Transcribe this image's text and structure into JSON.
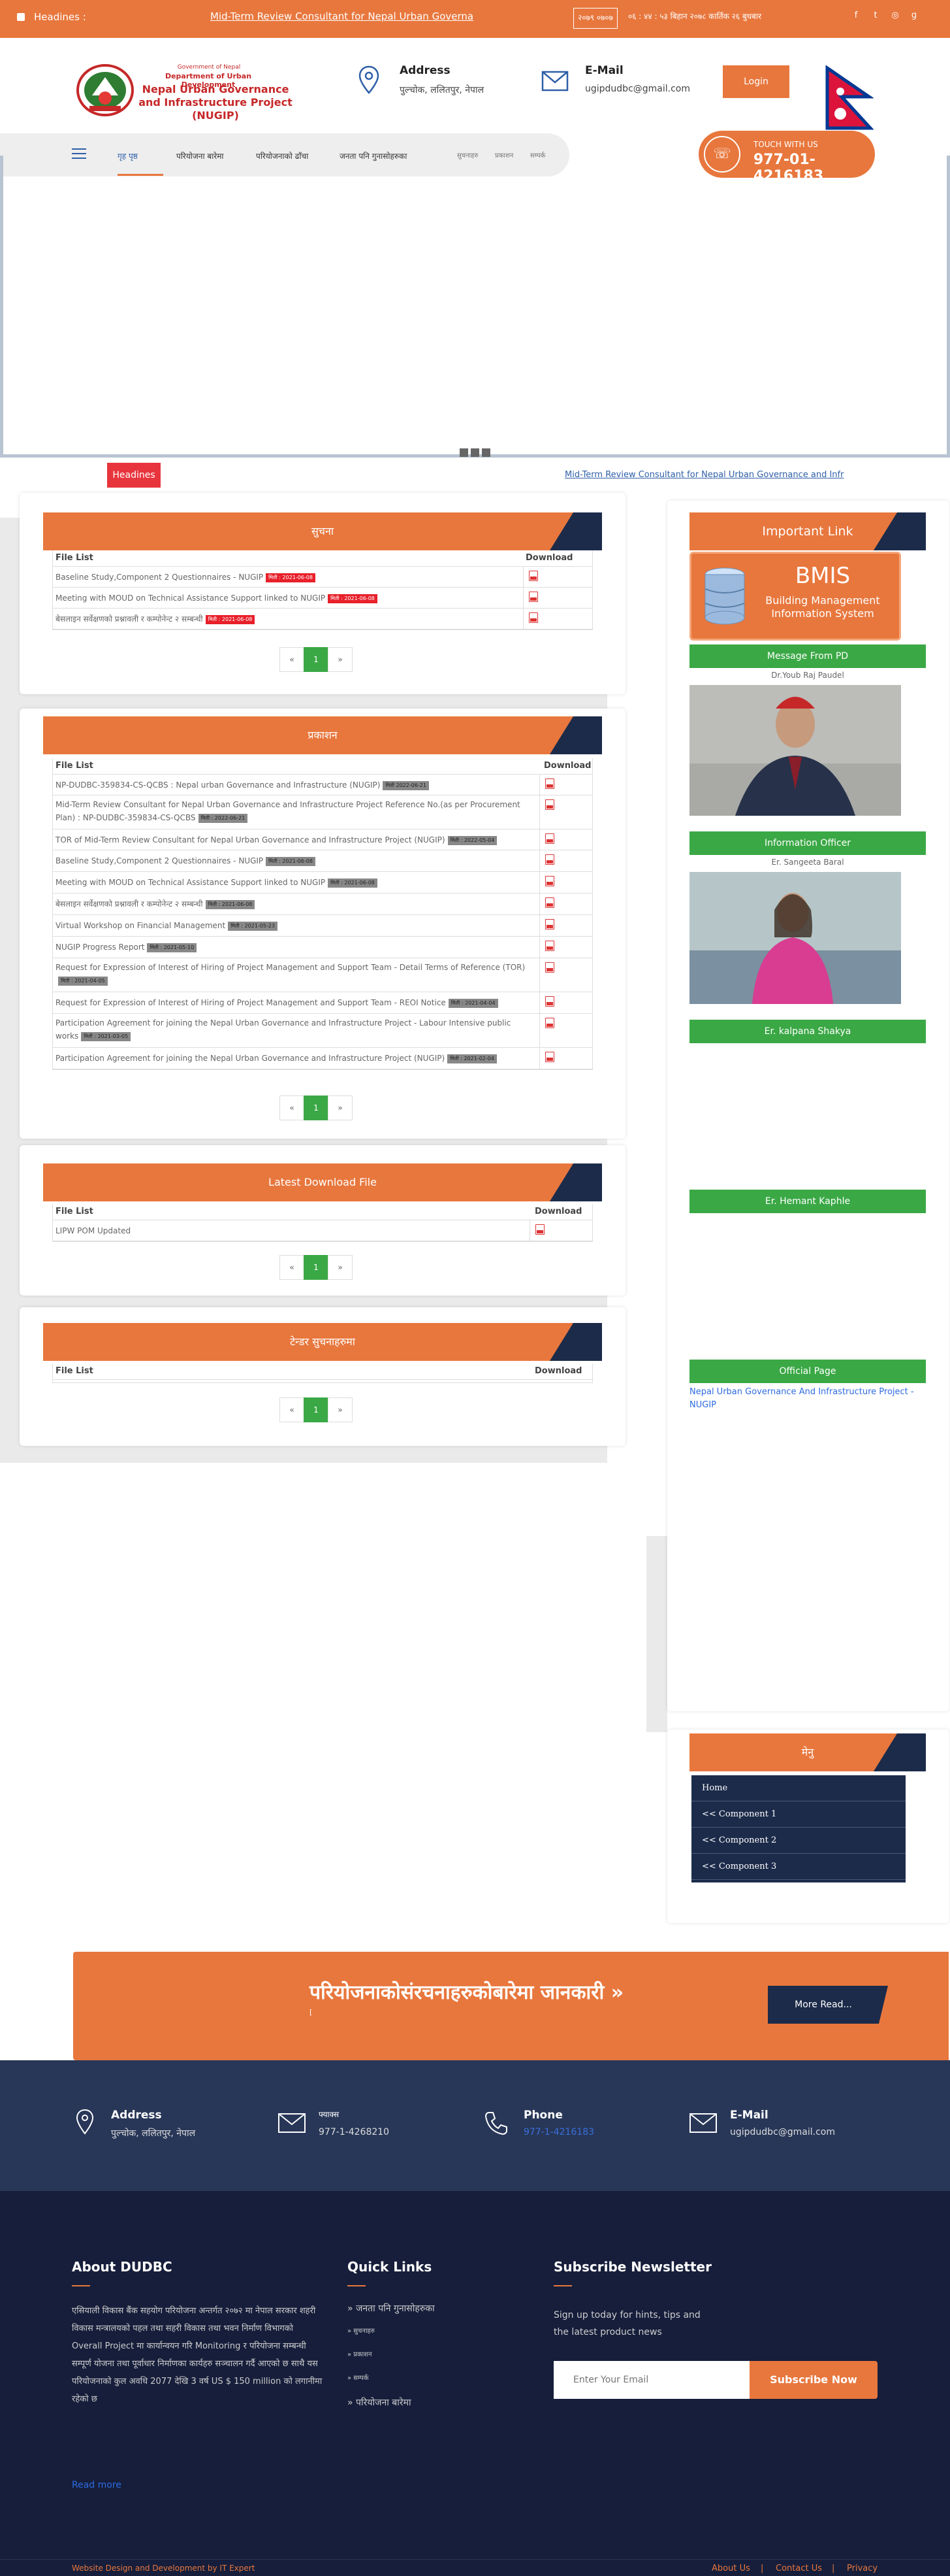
{
  "topbar": {
    "headlines_label": "Headines :",
    "marquee": "Mid-Term Review Consultant for Nepal Urban Governa",
    "datebox": "२०७९ ०७०७",
    "date": "०६ : ४४ : ५३ बिहान २०७८ कार्तिक २६ बुधबार",
    "social": [
      "f",
      "t",
      "◎",
      "g"
    ]
  },
  "header": {
    "gov": "Government of Nepal",
    "dept": "Department of Urban Development",
    "project": "Nepal Urban Governance and Infrastructure Project (NUGIP)",
    "address_title": "Address",
    "address_value": "पुल्चोक, ललितपुर, नेपाल",
    "email_title": "E-Mail",
    "email_value": "ugipdudbc@gmail.com",
    "login": "Login"
  },
  "nav": {
    "items": [
      "गृह पृष्ठ",
      "परियोजना बारेमा",
      "परियोजनाको ढाँचा",
      "जनता पनि गुनासोहरुका",
      "सुचनाहरु",
      "प्रकाशन",
      "सम्पर्क"
    ]
  },
  "touch": {
    "label": "TOUCH WITH US",
    "phone": "977-01-4216183"
  },
  "headline_bar": {
    "tag": "Headines",
    "link": "Mid-Term Review Consultant for Nepal Urban Governance and Infr"
  },
  "panels": [
    {
      "title": "सुचना",
      "col1": "File List",
      "col2": "Download",
      "rows": [
        {
          "text": "Baseline Study,Component 2 Questionnaires - NUGIP",
          "date": "मिती : 2021-06-08"
        },
        {
          "text": "Meeting with MOUD on Technical Assistance Support linked to NUGIP",
          "date": "मिती : 2021-06-08"
        },
        {
          "text": "बेसलाइन सर्वेक्षणको प्रश्नावली र कम्पोनेन्ट २ सम्बन्धी",
          "date": "मिती : 2021-06-08"
        }
      ],
      "page": "1"
    },
    {
      "title": "प्रकाशन",
      "col1": "File List",
      "col2": "Download",
      "rows": [
        {
          "text": "NP-DUDBC-359834-CS-QCBS : Nepal urban Governance and Infrastructure (NUGIP)",
          "date": "मिती 2022-06-21"
        },
        {
          "text": "Mid-Term Review Consultant for Nepal Urban Governance and Infrastructure Project Reference No.(as per Procurement Plan) : NP-DUDBC-359834-CS-QCBS",
          "date": "मिती : 2022-06-21"
        },
        {
          "text": "TOR of Mid-Term Review Consultant for Nepal Urban Governance and Infrastructure Project (NUGIP)",
          "date": "मिती : 2022-05-04"
        },
        {
          "text": "Baseline Study,Component 2 Questionnaires - NUGIP",
          "date": "मिती : 2021-06-08"
        },
        {
          "text": "Meeting with MOUD on Technical Assistance Support linked to NUGIP",
          "date": "मिती : 2021-06-08"
        },
        {
          "text": "बेसलाइन सर्वेक्षणको प्रश्नावली र कम्पोनेन्ट २ सम्बन्धी",
          "date": "मिती : 2021-06-08"
        },
        {
          "text": "Virtual Workshop on Financial Management",
          "date": "मिती : 2021-05-23"
        },
        {
          "text": "NUGIP Progress Report",
          "date": "मिती : 2021-05-10"
        },
        {
          "text": "Request for Expression of Interest of Hiring of Project Management and Support Team - Detail Terms of Reference (TOR)",
          "date": "मिती : 2021-04-05"
        },
        {
          "text": "Request for Expression of Interest of Hiring of Project Management and Support Team - REOI Notice",
          "date": "मिती : 2021-04-04"
        },
        {
          "text": "Participation Agreement for joining the Nepal Urban Governance and Infrastructure Project - Labour Intensive public works",
          "date": "मिती : 2021-03-05"
        },
        {
          "text": "Participation Agreement for joining the Nepal Urban Governance and Infrastructure Project (NUGIP)",
          "date": "मिती : 2021-02-04"
        }
      ],
      "page": "1"
    },
    {
      "title": "Latest Download File",
      "col1": "File List",
      "col2": "Download",
      "rows": [
        {
          "text": "LIPW POM Updated",
          "date": ""
        }
      ],
      "page": "1"
    },
    {
      "title": "टेन्डर सुचनाहरुमा",
      "col1": "File List",
      "col2": "Download",
      "rows": [],
      "page": "1"
    }
  ],
  "right": {
    "title": "Important Link",
    "bmis_title": "BMIS",
    "bmis_sub": "Building Management Information System",
    "message": "Message From PD",
    "pd_name": "Dr.Youb Raj Paudel",
    "info": "Information Officer",
    "info_name": "Er. Sangeeta Baral",
    "kalpana": "Er. kalpana Shakya",
    "hemant": "Er. Hemant Kaphle",
    "official": "Official Page",
    "official_link": "Nepal Urban Governance And Infrastructure Project - NUGIP",
    "menu_title": "मेनु",
    "menu": [
      "Home",
      "<< Component 1",
      "<< Component 2",
      "<< Component 3"
    ]
  },
  "banner": {
    "title": "परियोजनाकोसंरचनाहरुकोबारेमा जानकारी »",
    "sub": "[",
    "btn": "More Read..."
  },
  "contact": {
    "addr_t": "Address",
    "addr_v": "पुल्चोक, ललितपुर, नेपाल",
    "fax_t": "फ्याक्स",
    "fax_v": "977-1-4268210",
    "phone_t": "Phone",
    "phone_v": "977-1-4216183",
    "mail_t": "E-Mail",
    "mail_v": "ugipdudbc@gmail.com"
  },
  "footer": {
    "about_title": "About DUDBC",
    "about_text": "एसियाली विकास बैंक सहयोग परियोजना अन्तर्गत २०७२ मा नेपाल सरकार शहरी विकास मन्त्रालयको पहल तथा सहरी विकास तथा भवन निर्माण विभागको Overall Project मा कार्यान्वयन गरि Monitoring र परियोजना सम्बन्धी सम्पूर्ण योजना तथा पूर्वाधार निर्माणका कार्यहरु सञ्चालन गर्दै आएको छ साथै यस परियोजनाको कुल अवधि 2077 देखि 3 वर्ष US $ 150 million को लगानीमा रहेको छ",
    "read_more": "Read more",
    "quick_title": "Quick Links",
    "quick": [
      "» जनता पनि गुनासोहरुका",
      "» सुचनाहरु",
      "» प्रकाशन",
      "» सम्पर्क",
      "» परियोजना बारेमा"
    ],
    "news_title": "Subscribe Newsletter",
    "news_text": "Sign up today for hints, tips and the latest product news",
    "email_placeholder": "Enter Your Email",
    "subscribe": "Subscribe Now",
    "credit": "Website Design and Development by IT Expert",
    "links": [
      "About Us",
      "|",
      "Contact Us",
      "|",
      "Privacy"
    ]
  }
}
